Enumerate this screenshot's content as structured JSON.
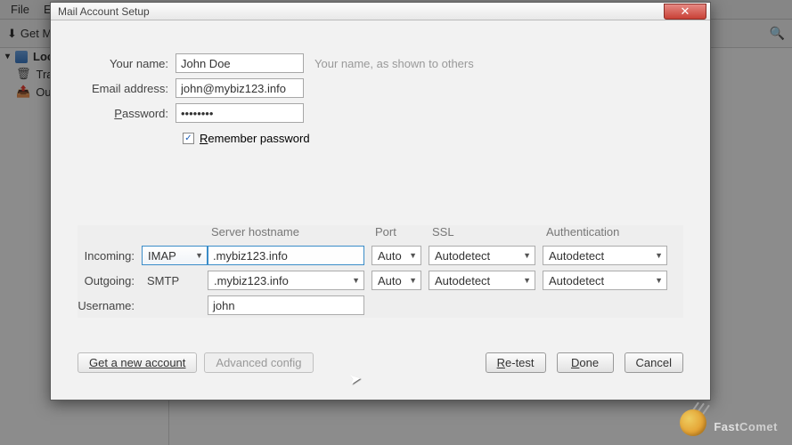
{
  "bg": {
    "menu": {
      "file": "File",
      "edit": "Edi"
    },
    "get_mail": "Get M",
    "sidebar": {
      "local": "Loca",
      "trash": "Tra",
      "outbox": "Ou"
    }
  },
  "dialog": {
    "title": "Mail Account Setup",
    "top": {
      "name_label": "Your name:",
      "name_value": "John Doe",
      "name_help": "Your name, as shown to others",
      "email_label": "Email address:",
      "email_value": "john@mybiz123.info",
      "password_label": "Password:",
      "password_value": "••••••••",
      "remember_prefix": "R",
      "remember_rest": "emember password"
    },
    "headers": {
      "host": "Server hostname",
      "port": "Port",
      "ssl": "SSL",
      "auth": "Authentication"
    },
    "incoming": {
      "label": "Incoming:",
      "proto": "IMAP",
      "host": ".mybiz123.info",
      "port": "Auto",
      "ssl": "Autodetect",
      "auth": "Autodetect"
    },
    "outgoing": {
      "label": "Outgoing:",
      "proto": "SMTP",
      "host": ".mybiz123.info",
      "port": "Auto",
      "ssl": "Autodetect",
      "auth": "Autodetect"
    },
    "username": {
      "label": "Username:",
      "value": "john"
    },
    "buttons": {
      "get_new": "Get a new account",
      "advanced": "Advanced config",
      "retest": "Re-test",
      "done": "Done",
      "cancel": "Cancel"
    }
  },
  "watermark": {
    "brand_bold": "Fast",
    "brand_rest": "Comet"
  }
}
